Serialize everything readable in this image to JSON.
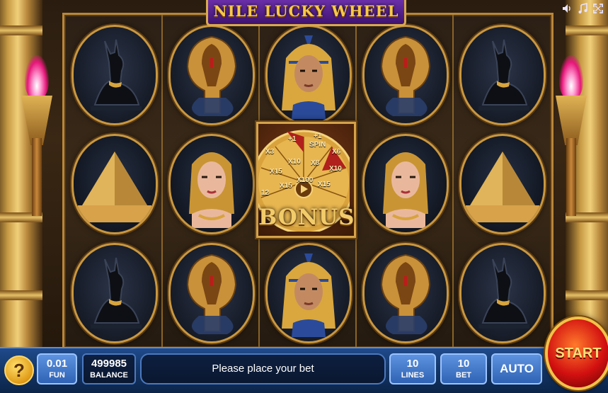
{
  "game": {
    "title": "NILE LUCKY WHEEL"
  },
  "toolbar": {
    "icons": [
      "volume-icon",
      "music-icon",
      "fullscreen-icon"
    ]
  },
  "reels": [
    [
      "anubis",
      "pyramid",
      "anubis"
    ],
    [
      "cobra",
      "cleopatra",
      "cobra"
    ],
    [
      "pharaoh",
      "bonus-wheel",
      "pharaoh"
    ],
    [
      "cobra",
      "cleopatra",
      "cobra"
    ],
    [
      "anubis",
      "pyramid",
      "anubis"
    ]
  ],
  "bonus": {
    "label": "BONUS",
    "wheel_segments": [
      "+1",
      "+1",
      "SPIN",
      "X3",
      "X6",
      "X15",
      "X10",
      "X8",
      "X10",
      "X15",
      "X100",
      "X15",
      "X10",
      "X8",
      "12"
    ]
  },
  "bottom_bar": {
    "help_label": "?",
    "coin": {
      "value": "0.01",
      "label": "FUN"
    },
    "balance": {
      "value": "499985",
      "label": "BALANCE"
    },
    "message": "Please place your bet",
    "lines": {
      "value": "10",
      "label": "LINES"
    },
    "bet": {
      "value": "10",
      "label": "BET"
    },
    "auto_label": "AUTO",
    "start_label": "START"
  },
  "colors": {
    "title_bg": "#4a1a80",
    "title_text": "#f7c948",
    "bar_bg": "#123464",
    "start_red": "#d21010",
    "gold": "#c9973f"
  }
}
